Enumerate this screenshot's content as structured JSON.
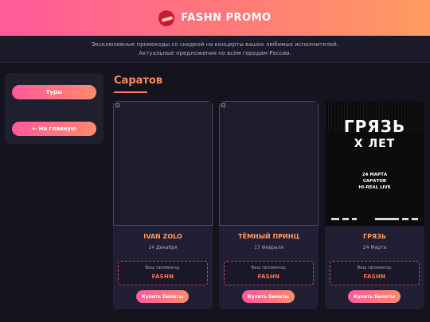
{
  "header": {
    "brand": "FASHN PROMO",
    "logo_icon": "fashn-logo-icon"
  },
  "subheader": {
    "line1": "Эксклюзивные промокоды со скидкой на концерты ваших любимых исполнителей.",
    "line2": "Актуальные предложения по всем городам России."
  },
  "sidebar": {
    "tours_label": "Туры",
    "home_label": "← На главную"
  },
  "page": {
    "city": "Саратов"
  },
  "cards": [
    {
      "artist": "IVAN ZOLO",
      "date": "14 Декабря",
      "promo_label": "Ваш промокод:",
      "promo_code": "FASHN",
      "buy_label": "Купить билеты",
      "poster": "broken-image"
    },
    {
      "artist": "ТЁМНЫЙ ПРИНЦ",
      "date": "17 Февраля",
      "promo_label": "Ваш промокод:",
      "promo_code": "FASHN",
      "buy_label": "Купить билеты",
      "poster": "broken-image"
    },
    {
      "artist": "ГРЯЗЬ",
      "date": "24 Марта",
      "promo_label": "Ваш промокод:",
      "promo_code": "FASHN",
      "buy_label": "Купить билеты",
      "poster": "poster-image",
      "poster_text": {
        "title": "ГРЯЗЬ",
        "subtitle": "X ЛЕТ",
        "line1": "24 МАРТА",
        "line2": "САРАТОВ",
        "line3": "HI-REAL LIVE"
      }
    }
  ],
  "colors": {
    "accent_start": "#ff5a9a",
    "accent_end": "#ff9c62",
    "background": "#15131e",
    "card": "#211f33"
  }
}
